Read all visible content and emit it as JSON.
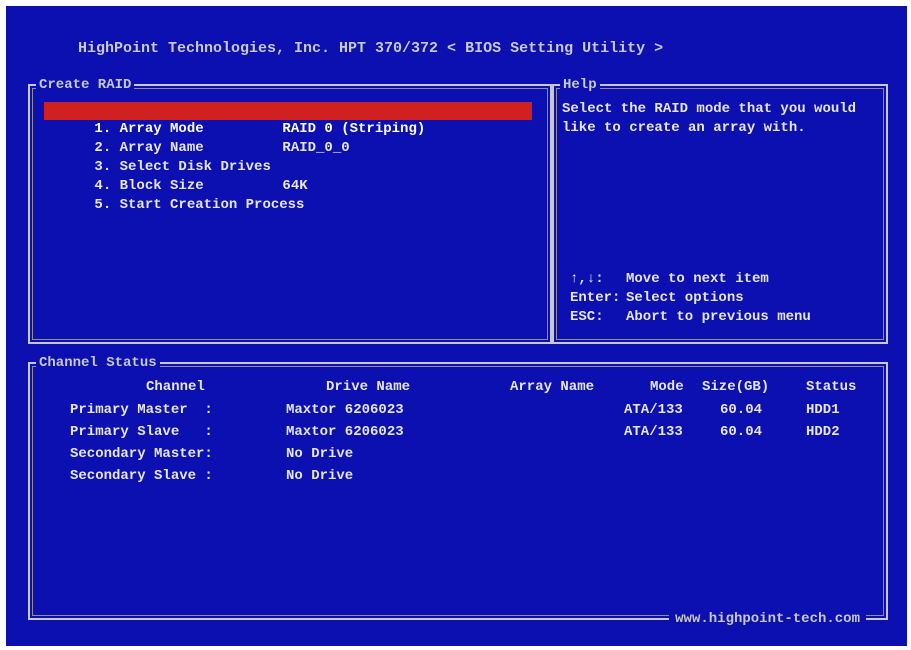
{
  "title": "HighPoint Technologies, Inc. HPT 370/372 < BIOS Setting Utility >",
  "create_raid": {
    "legend": "Create RAID",
    "items": [
      {
        "label": "1. Array Mode",
        "value": "RAID 0 (Striping)"
      },
      {
        "label": "2. Array Name",
        "value": "RAID_0_0"
      },
      {
        "label": "3. Select Disk Drives",
        "value": ""
      },
      {
        "label": "4. Block Size",
        "value": "64K"
      },
      {
        "label": "5. Start Creation Process",
        "value": ""
      }
    ],
    "selected_index": 0
  },
  "help": {
    "legend": "Help",
    "text": "Select the RAID mode that you would like to create an array with.",
    "keys": [
      {
        "key": "↑,↓:",
        "desc": "Move to next item"
      },
      {
        "key": "Enter:",
        "desc": "Select options"
      },
      {
        "key": "ESC:",
        "desc": "Abort to previous menu"
      }
    ]
  },
  "channel_status": {
    "legend": "Channel Status",
    "headers": {
      "channel": "Channel",
      "drive_name": "Drive Name",
      "array_name": "Array Name",
      "mode": "Mode",
      "size": "Size(GB)",
      "status": "Status"
    },
    "rows": [
      {
        "channel": "Primary Master  :",
        "drive": "Maxtor 6206023",
        "array": "",
        "mode": "ATA/133",
        "size": "60.04",
        "status": "HDD1"
      },
      {
        "channel": "Primary Slave   :",
        "drive": "Maxtor 6206023",
        "array": "",
        "mode": "ATA/133",
        "size": "60.04",
        "status": "HDD2"
      },
      {
        "channel": "Secondary Master:",
        "drive": "No Drive",
        "array": "",
        "mode": "",
        "size": "",
        "status": ""
      },
      {
        "channel": "Secondary Slave :",
        "drive": "No Drive",
        "array": "",
        "mode": "",
        "size": "",
        "status": ""
      }
    ],
    "footer": "www.highpoint-tech.com"
  },
  "colors": {
    "background": "#0c10b0",
    "highlight": "#d02020",
    "text": "#e6e6e6",
    "border": "#c8c8c8"
  }
}
